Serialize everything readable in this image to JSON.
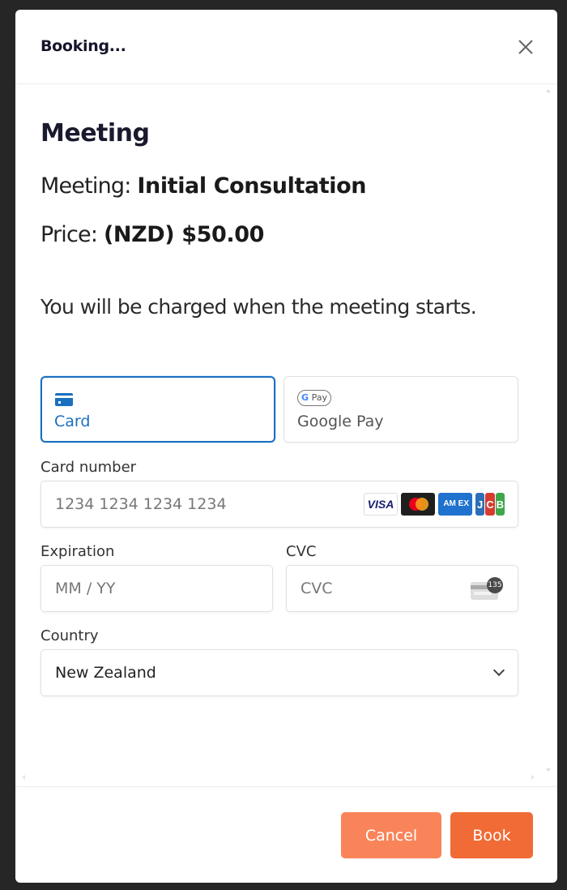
{
  "header": {
    "title": "Booking...",
    "close_icon": "close-icon"
  },
  "content": {
    "section_title": "Meeting",
    "meeting_label": "Meeting:",
    "meeting_value": "Initial Consultation",
    "price_label": "Price:",
    "price_value": "(NZD) $50.00",
    "notice": "You will be charged when the meeting starts."
  },
  "payment_methods": [
    {
      "label": "Card",
      "icon": "credit-card-icon",
      "selected": true
    },
    {
      "label": "Google Pay",
      "icon": "google-pay-icon",
      "icon_text_g": "G",
      "icon_text_pay": "Pay",
      "selected": false
    }
  ],
  "form": {
    "card_number": {
      "label": "Card number",
      "placeholder": "1234 1234 1234 1234",
      "value": ""
    },
    "card_brands": {
      "visa": "VISA",
      "mastercard": "",
      "amex": "AM EX",
      "jcb": [
        "J",
        "C",
        "B"
      ]
    },
    "expiration": {
      "label": "Expiration",
      "placeholder": "MM / YY",
      "value": ""
    },
    "cvc": {
      "label": "CVC",
      "placeholder": "CVC",
      "value": "",
      "icon_number": "135"
    },
    "country": {
      "label": "Country",
      "value": "New Zealand"
    }
  },
  "footer": {
    "cancel_label": "Cancel",
    "book_label": "Book"
  },
  "colors": {
    "selected_accent": "#1a6fc0",
    "cancel_button": "#f98459",
    "book_button": "#f06b35",
    "backdrop": "#262626"
  }
}
